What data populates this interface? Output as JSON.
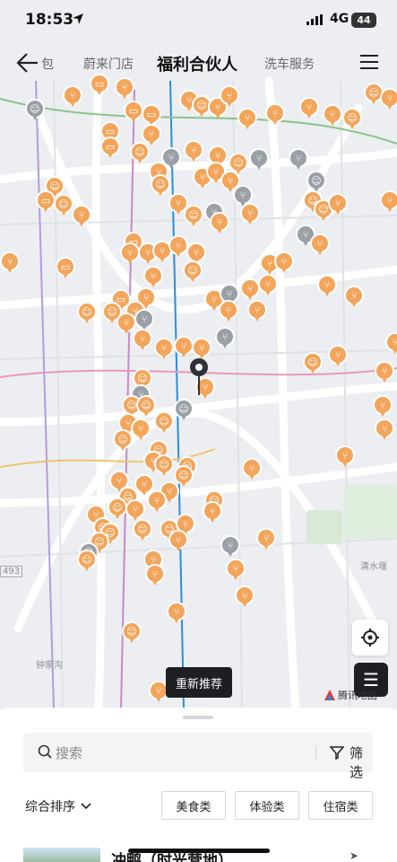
{
  "status_bar": {
    "time": "18:53",
    "network": "4G",
    "battery": "44"
  },
  "navbar": {
    "tabs": [
      "包",
      "蔚来门店",
      "福利合伙人",
      "洗车服务"
    ],
    "active_tab": "福利合伙人"
  },
  "map": {
    "labels": {
      "qingshuiba": "清水堰",
      "zhongjiagou": "钟家沟",
      "road_493": "493"
    },
    "refresh_button": "重新推荐",
    "provider": "腾讯地图",
    "colors": {
      "poi_orange": "#f2a55b",
      "poi_gray": "#9aa0a6",
      "metro_blue": "#2a8fd6"
    }
  },
  "sheet": {
    "search_placeholder": "搜索",
    "filter_label": "筛选",
    "sort_label": "综合排序",
    "categories": [
      "美食类",
      "体验类",
      "住宿类"
    ],
    "first_result_name": "冲鸭（时光营地）"
  }
}
